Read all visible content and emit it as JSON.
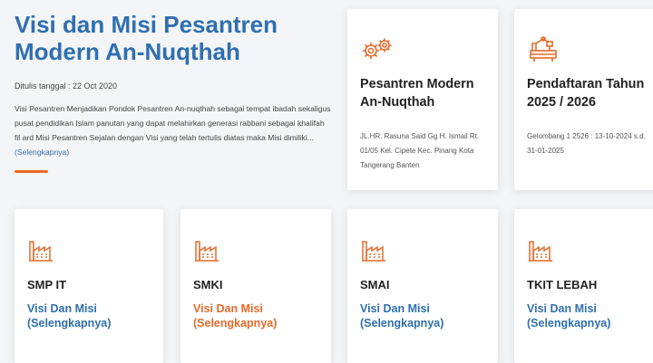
{
  "hero": {
    "title": "Visi dan Misi Pesantren Modern An-Nuqthah",
    "date": "Ditulis tanggal : 22 Oct 2020",
    "description": "Visi Pesantren Menjadikan Pondok Pesantren An-nuqthah sebagai tempat ibadah sekaligus pusat pendidikan Islam panutan yang dapat melahirkan generasi rabbani sebagai khalifah fil ard Misi Pesantren Sejalan dengan Visi yang telah tertulis diatas maka Misi dimiliki...",
    "more_link": "(Selengkapnya)"
  },
  "top_cards": [
    {
      "icon": "gears-icon",
      "title": "Pesantren Modern An-Nuqthah",
      "text": "JL.HR. Rasuna Said Gg H. Ismail Rt. 01/05 Kel. Cipete Kec. Pinang Kota Tangerang Banten"
    },
    {
      "icon": "machine-icon",
      "title": "Pendaftaran Tahun 2025 / 2026",
      "text": "Gelombang 1 2526 : 13-10-2024 s.d. 31-01-2025"
    }
  ],
  "bottom_cards": [
    {
      "icon": "factory-icon",
      "title": "SMP IT",
      "link_line1": "Visi Dan Misi",
      "link_line2": "(Selengkapnya)"
    },
    {
      "icon": "factory-icon",
      "title": "SMKI",
      "link_line1": "Visi Dan Misi",
      "link_line2": "(Selengkapnya)"
    },
    {
      "icon": "factory-icon",
      "title": "SMAI",
      "link_line1": "Visi Dan Misi",
      "link_line2": "(Selengkapnya)"
    },
    {
      "icon": "factory-icon",
      "title": "TKIT LEBAH",
      "link_line1": "Visi Dan Misi",
      "link_line2": "(Selengkapnya)"
    }
  ],
  "colors": {
    "accent_blue": "#2f6fb0",
    "accent_orange": "#e86a2a",
    "background": "#f3f5f8"
  }
}
